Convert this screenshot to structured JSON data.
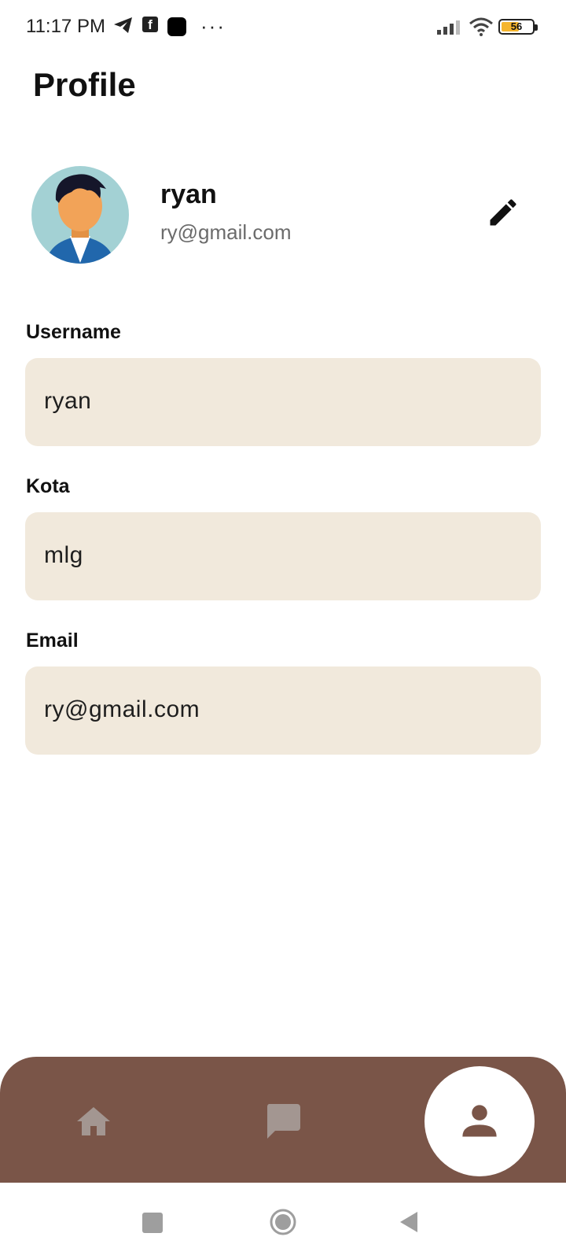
{
  "status_bar": {
    "time": "11:17 PM",
    "icons": [
      "telegram-icon",
      "facebook-icon",
      "app-icon",
      "more-dots-icon",
      "signal-icon",
      "wifi-icon",
      "battery-icon"
    ],
    "battery_level": "56",
    "more": "···"
  },
  "header": {
    "title": "Profile"
  },
  "profile": {
    "name": "ryan",
    "email": "ry@gmail.com",
    "edit_icon": "pencil-icon"
  },
  "form": {
    "fields": [
      {
        "label": "Username",
        "value": "ryan"
      },
      {
        "label": "Kota",
        "value": "mlg"
      },
      {
        "label": "Email",
        "value": "ry@gmail.com"
      }
    ]
  },
  "bottom_nav": {
    "items": [
      {
        "icon": "home-icon",
        "active": false
      },
      {
        "icon": "chat-icon",
        "active": false
      },
      {
        "icon": "person-icon",
        "active": true
      }
    ]
  },
  "colors": {
    "field_background": "#f1e9dc",
    "nav_background": "#7a5548",
    "nav_inactive_icon": "#a39691",
    "nav_active_icon": "#7a5548"
  }
}
